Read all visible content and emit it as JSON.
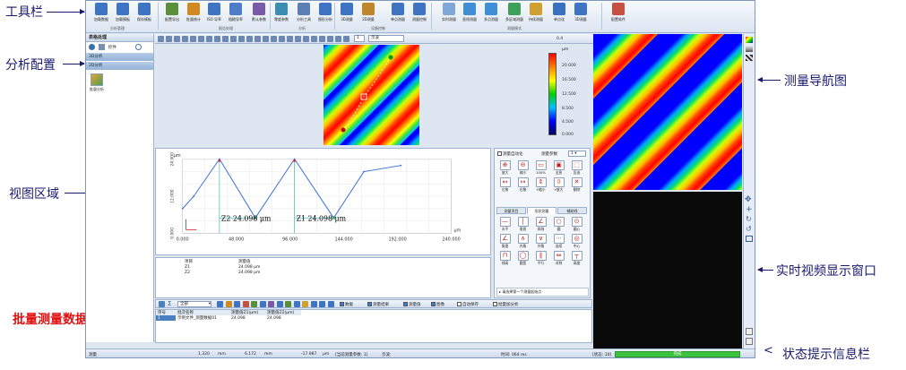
{
  "annotations": {
    "toolbar": "工具栏",
    "analysis_config": "分析配置",
    "view_area": "视图区域",
    "batch_stats": "批量测量数据统计",
    "nav_map": "测量导航图",
    "live_video": "实时视频显示窗口",
    "status_bar": "状态提示信息栏"
  },
  "ribbon": {
    "buttons": [
      "加载数据",
      "加载模板",
      "保存模板",
      "配置导出",
      "批量统计",
      "ISO 导率",
      "粗糙导率",
      "默认参数",
      "零度参数",
      "分析工具",
      "图形分析",
      "3D测量",
      "2D测量",
      "单点测量",
      "测量控制",
      "实时测量",
      "直线测量",
      "多点测量",
      "多区域测量",
      "持续测量",
      "单点化",
      "3D测量",
      "配置软件"
    ],
    "groups": [
      "分析管理",
      "报告处理",
      "分析",
      "设备控制",
      "测量模式"
    ]
  },
  "left_panel": {
    "header": "表格处理",
    "view_label": "控件",
    "section_3d": "3D分析",
    "section_2d": "2D分析",
    "item_label": "批量分析"
  },
  "view_toolbar": {
    "combo1": "1",
    "combo2": "示波",
    "value": "0.4"
  },
  "colorbar": {
    "unit": "μm",
    "labels": [
      "20.000",
      "16.500",
      "12.500",
      "8.500",
      "4.500",
      "0.000"
    ]
  },
  "chart_data": {
    "type": "line",
    "ylabel": "μm",
    "xlabel": "μm",
    "x_ticks": [
      "0.000",
      "48.000",
      "96.000",
      "144.000",
      "192.000",
      "240.000"
    ],
    "y_ticks": [
      "24.000",
      "12.000",
      "0.000"
    ],
    "xlim": [
      0,
      240
    ],
    "ylim": [
      0,
      24
    ],
    "x": [
      0,
      10,
      33,
      65,
      100,
      135,
      162,
      195
    ],
    "y": [
      8,
      12,
      24.09,
      5,
      24.09,
      5,
      20,
      22
    ],
    "annotations": [
      "Z2 24.098 μm",
      "Z1 24.098 μm"
    ]
  },
  "tool_panel": {
    "checkbox": "测量自动化",
    "combo_label": "测量参数",
    "combo_value": "1",
    "row1": [
      "放大",
      "缩小",
      "100%",
      "全息",
      "反选"
    ],
    "row2": [
      "左移",
      "右移",
      "Y缩小",
      "Y放大",
      "删除"
    ],
    "tabs": [
      "测量项目",
      "形状测量",
      "辅助线"
    ],
    "row3": [
      "水平",
      "垂直",
      "斜线",
      "圆",
      "圆心"
    ],
    "row4": [
      "角度",
      "内角",
      "外角",
      "连续",
      "中心"
    ],
    "row5": [
      "线高",
      "圆宽",
      "平行",
      "对称",
      "高度"
    ],
    "hint": "请选择第一个测量起始点"
  },
  "result_table": {
    "headers": [
      "项目",
      "测量值"
    ],
    "rows": [
      [
        "Z1",
        "24.098 μm"
      ],
      [
        "Z2",
        "24.098 μm"
      ]
    ]
  },
  "batch": {
    "combo": "全部",
    "checks": [
      "数据",
      "测量结果",
      "测量值",
      "图像",
      "自动保存",
      "批量加分析"
    ],
    "headers": [
      "序号",
      "批次名称",
      "测量值Z1(μm)",
      "测量值Z2(μm)"
    ],
    "rows": [
      [
        "1",
        "示例文件_测量数据01",
        "24.098",
        "24.098"
      ]
    ]
  },
  "status": {
    "left": "测量",
    "x": "1.320",
    "xunit": "mm",
    "y": "6.172",
    "yunit": "mm",
    "z": "-17.987",
    "zunit": "μm",
    "info": "[当前测量参数: 1]",
    "mode": "示波:",
    "time": "时间: 064 ms",
    "state": "[状态: 10]",
    "progress": "完成"
  }
}
